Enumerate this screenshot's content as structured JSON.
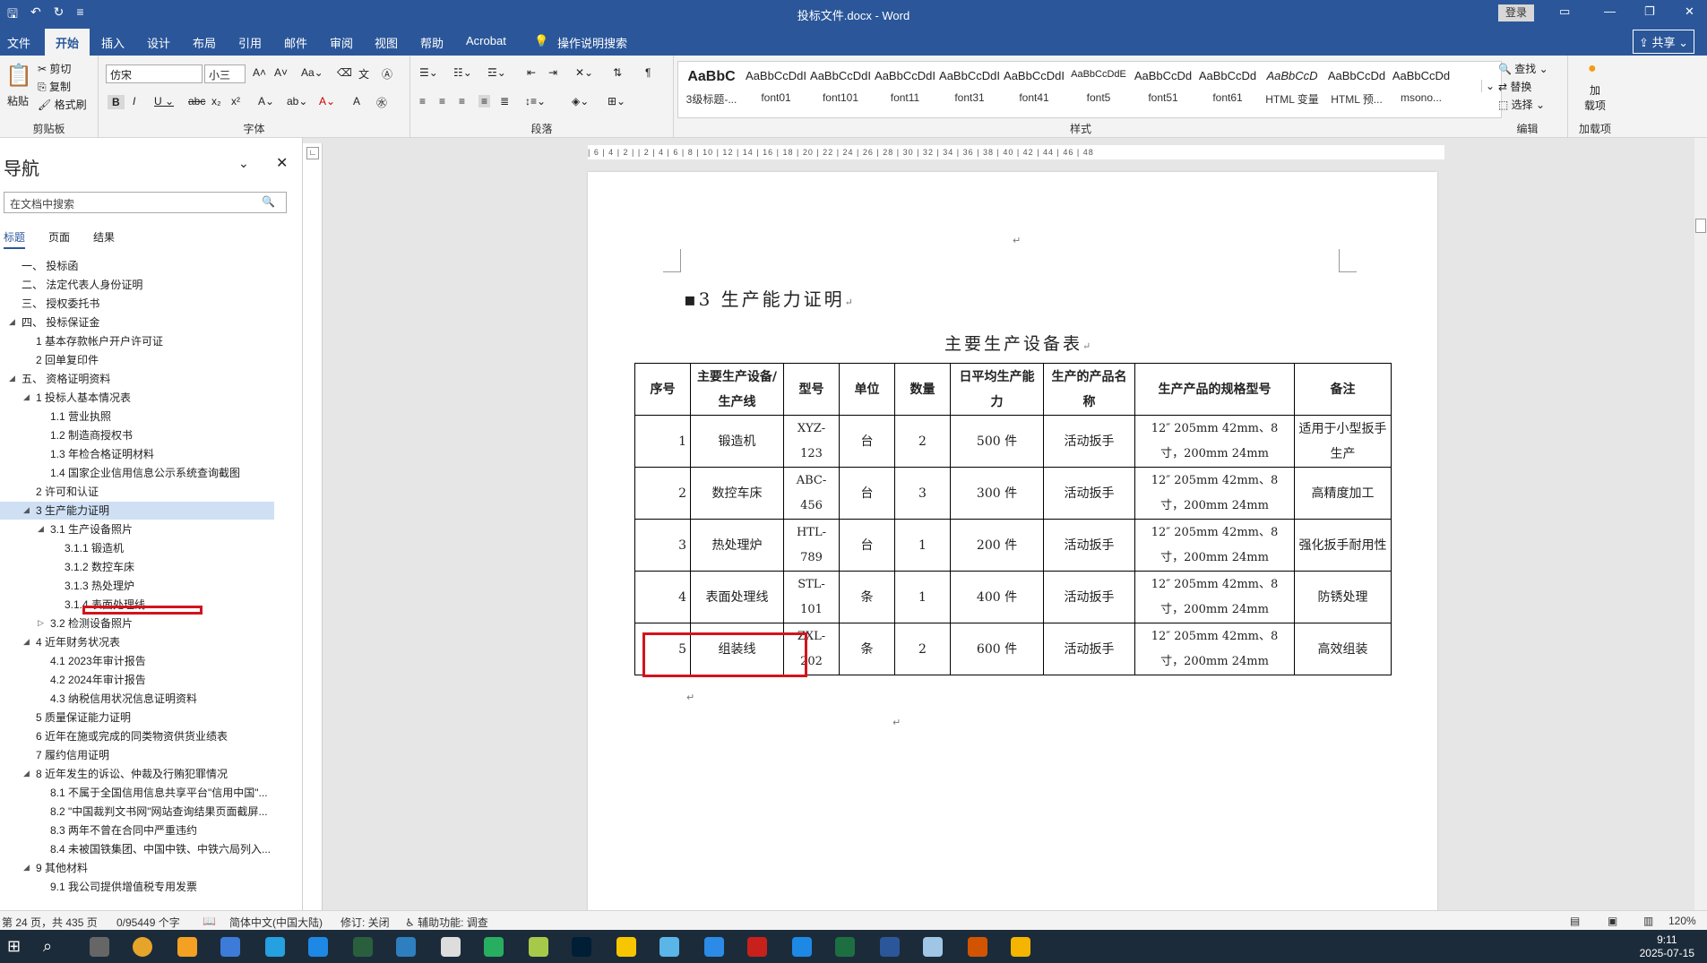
{
  "window": {
    "title": "投标文件.docx - Word",
    "login": "登录"
  },
  "tabs": [
    "文件",
    "开始",
    "插入",
    "设计",
    "布局",
    "引用",
    "邮件",
    "审阅",
    "视图",
    "帮助",
    "Acrobat"
  ],
  "tell_me": "操作说明搜索",
  "share": "共享",
  "ribbon": {
    "clipboard": {
      "paste": "粘贴",
      "cut": "剪切",
      "copy": "复制",
      "format_painter": "格式刷",
      "label": "剪贴板"
    },
    "font": {
      "name": "仿宋",
      "size": "小三",
      "label": "字体"
    },
    "paragraph": {
      "label": "段落"
    },
    "styles": {
      "label": "样式",
      "items": [
        {
          "preview": "AaBbC",
          "name": "3级标题-..."
        },
        {
          "preview": "AaBbCcDdI",
          "name": "font01"
        },
        {
          "preview": "AaBbCcDdI",
          "name": "font101"
        },
        {
          "preview": "AaBbCcDdI",
          "name": "font11"
        },
        {
          "preview": "AaBbCcDdI",
          "name": "font31"
        },
        {
          "preview": "AaBbCcDdI",
          "name": "font41"
        },
        {
          "preview": "AaBbCcDdE",
          "name": "font5"
        },
        {
          "preview": "AaBbCcDd",
          "name": "font51"
        },
        {
          "preview": "AaBbCcDd",
          "name": "font61"
        },
        {
          "preview": "AaBbCcD",
          "name": "HTML 变量"
        },
        {
          "preview": "AaBbCcDd",
          "name": "HTML 预..."
        },
        {
          "preview": "AaBbCcDd",
          "name": "msono..."
        }
      ]
    },
    "editing": {
      "find": "查找",
      "replace": "替换",
      "select": "选择",
      "label": "编辑"
    },
    "addins": {
      "name": "加\n载项",
      "label": "加载项"
    }
  },
  "nav": {
    "title": "导航",
    "search_placeholder": "在文档中搜索",
    "tabs": [
      "标题",
      "页面",
      "结果"
    ],
    "items": [
      {
        "text": "一、 投标函",
        "lvl": 1,
        "tri": ""
      },
      {
        "text": "二、 法定代表人身份证明",
        "lvl": 1,
        "tri": ""
      },
      {
        "text": "三、 授权委托书",
        "lvl": 1,
        "tri": ""
      },
      {
        "text": "四、 投标保证金",
        "lvl": 1,
        "tri": "◢"
      },
      {
        "text": "1 基本存款帐户开户许可证",
        "lvl": 2,
        "tri": ""
      },
      {
        "text": "2 回单复印件",
        "lvl": 2,
        "tri": ""
      },
      {
        "text": "五、 资格证明资料",
        "lvl": 1,
        "tri": "◢"
      },
      {
        "text": "1 投标人基本情况表",
        "lvl": 2,
        "tri": "◢"
      },
      {
        "text": "1.1 营业执照",
        "lvl": 3,
        "tri": ""
      },
      {
        "text": "1.2 制造商授权书",
        "lvl": 3,
        "tri": ""
      },
      {
        "text": "1.3 年检合格证明材料",
        "lvl": 3,
        "tri": ""
      },
      {
        "text": "1.4 国家企业信用信息公示系统查询截图",
        "lvl": 3,
        "tri": ""
      },
      {
        "text": "2 许可和认证",
        "lvl": 2,
        "tri": ""
      },
      {
        "text": "3 生产能力证明",
        "lvl": 2,
        "tri": "◢",
        "cur": true
      },
      {
        "text": "3.1 生产设备照片",
        "lvl": 3,
        "tri": "◢"
      },
      {
        "text": "3.1.1 锻造机",
        "lvl": 4,
        "tri": ""
      },
      {
        "text": "3.1.2 数控车床",
        "lvl": 4,
        "tri": ""
      },
      {
        "text": "3.1.3 热处理炉",
        "lvl": 4,
        "tri": ""
      },
      {
        "text": "3.1.4 表面处理线",
        "lvl": 4,
        "tri": ""
      },
      {
        "text": "3.2 检测设备照片",
        "lvl": 3,
        "tri": "▷"
      },
      {
        "text": "4 近年财务状况表",
        "lvl": 2,
        "tri": "◢"
      },
      {
        "text": "4.1 2023年审计报告",
        "lvl": 3,
        "tri": ""
      },
      {
        "text": "4.2 2024年审计报告",
        "lvl": 3,
        "tri": ""
      },
      {
        "text": "4.3 纳税信用状况信息证明资料",
        "lvl": 3,
        "tri": ""
      },
      {
        "text": "5 质量保证能力证明",
        "lvl": 2,
        "tri": ""
      },
      {
        "text": "6 近年在施或完成的同类物资供货业绩表",
        "lvl": 2,
        "tri": ""
      },
      {
        "text": "7 履约信用证明",
        "lvl": 2,
        "tri": ""
      },
      {
        "text": "8 近年发生的诉讼、仲裁及行贿犯罪情况",
        "lvl": 2,
        "tri": "◢"
      },
      {
        "text": "8.1 不属于全国信用信息共享平台\"信用中国\"...",
        "lvl": 3,
        "tri": ""
      },
      {
        "text": "8.2 \"中国裁判文书网\"网站查询结果页面截屏...",
        "lvl": 3,
        "tri": ""
      },
      {
        "text": "8.3 两年不曾在合同中严重违约",
        "lvl": 3,
        "tri": ""
      },
      {
        "text": "8.4 未被国铁集团、中国中铁、中铁六局列入...",
        "lvl": 3,
        "tri": ""
      },
      {
        "text": "9 其他材料",
        "lvl": 2,
        "tri": "◢"
      },
      {
        "text": "9.1 我公司提供增值税专用发票",
        "lvl": 3,
        "tri": ""
      }
    ]
  },
  "ruler": "| 6 | 4 | 2 |   | 2 | 4 | 6 | 8 | 10 | 12 | 14 | 16 | 18 | 20 | 22 | 24 | 26 | 28 | 30 | 32 | 34 | 36 | 38 | 40 | 42 | 44 | 46 | 48",
  "doc": {
    "heading": "3  生产能力证明",
    "table_title": "主要生产设备表",
    "headers": [
      "序号",
      "主要生产设备/生产线",
      "型号",
      "单位",
      "数量",
      "日平均生产能力",
      "生产的产品名称",
      "生产产品的规格型号",
      "备注"
    ],
    "rows": [
      [
        "1",
        "锻造机",
        "XYZ-123",
        "台",
        "2",
        "500 件",
        "活动扳手",
        "12″ 205mm 42mm、8 寸，200mm 24mm",
        "适用于小型扳手生产"
      ],
      [
        "2",
        "数控车床",
        "ABC-456",
        "台",
        "3",
        "300 件",
        "活动扳手",
        "12″ 205mm 42mm、8 寸，200mm 24mm",
        "高精度加工"
      ],
      [
        "3",
        "热处理炉",
        "HTL-789",
        "台",
        "1",
        "200 件",
        "活动扳手",
        "12″ 205mm 42mm、8 寸，200mm 24mm",
        "强化扳手耐用性"
      ],
      [
        "4",
        "表面处理线",
        "STL-101",
        "条",
        "1",
        "400 件",
        "活动扳手",
        "12″ 205mm 42mm、8 寸，200mm 24mm",
        "防锈处理"
      ],
      [
        "5",
        "组装线",
        "ZXL-202",
        "条",
        "2",
        "600 件",
        "活动扳手",
        "12″ 205mm 42mm、8 寸，200mm 24mm",
        "高效组装"
      ]
    ]
  },
  "status": {
    "page": "第 24 页，共 435 页",
    "words": "0/95449 个字",
    "lang": "简体中文(中国大陆)",
    "track": "修订: 关闭",
    "access": "辅助功能: 调查",
    "zoom": "120%"
  },
  "clock": {
    "time": "9:11",
    "date": "2025-07-15"
  },
  "colors": {
    "brand": "#2b579a",
    "highlight": "#d3141c"
  }
}
